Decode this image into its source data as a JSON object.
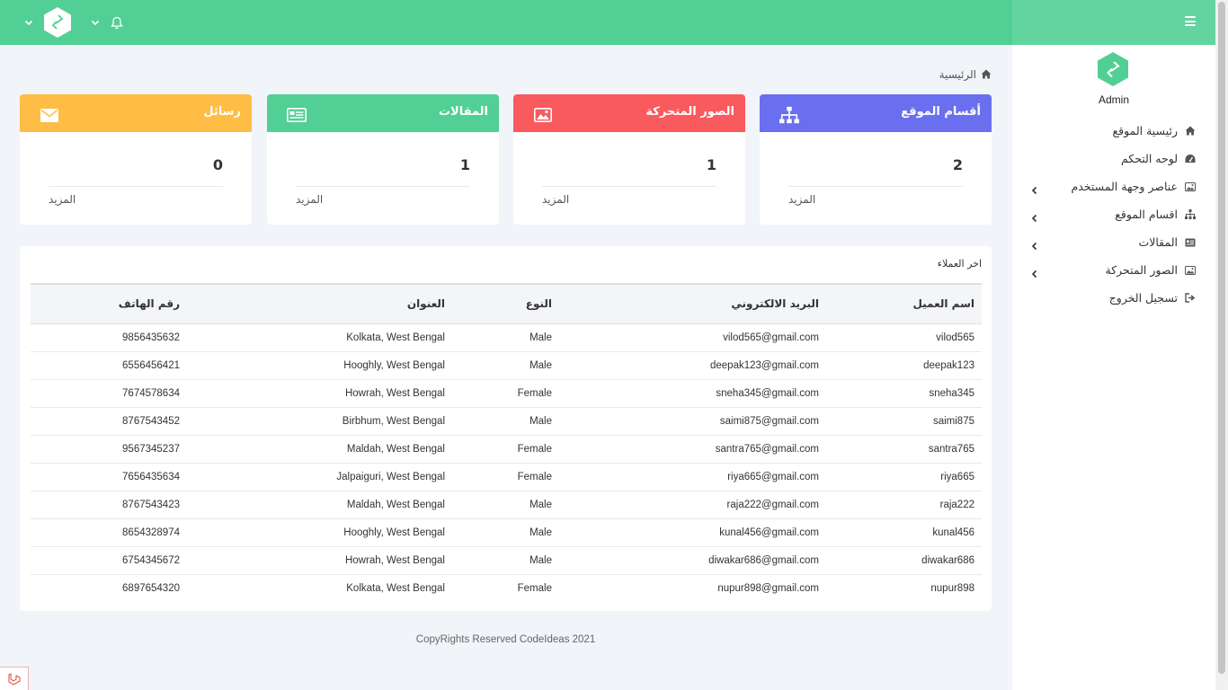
{
  "colors": {
    "brand_green": "#52cf95",
    "card_sections": "#6a6ff0",
    "card_sliders": "#f85a5e",
    "card_articles": "#52cf95",
    "card_messages": "#ffbd45"
  },
  "topbar": {
    "icons": [
      "chevron-down-icon",
      "logo-icon",
      "chevron-down-icon",
      "bell-icon"
    ]
  },
  "sidebar": {
    "user_name": "Admin",
    "items": [
      {
        "label": "رئيسية الموقع",
        "icon": "home-icon",
        "has_submenu": false
      },
      {
        "label": "لوحه التحكم",
        "icon": "dashboard-icon",
        "has_submenu": false
      },
      {
        "label": "عناصر وجهة المستخدم",
        "icon": "image-icon",
        "has_submenu": true
      },
      {
        "label": "اقسام الموقع",
        "icon": "sitemap-icon",
        "has_submenu": true
      },
      {
        "label": "المقالات",
        "icon": "newspaper-icon",
        "has_submenu": true
      },
      {
        "label": "الصور المتحركة",
        "icon": "image-icon",
        "has_submenu": true
      },
      {
        "label": "تسجيل الخروج",
        "icon": "sign-out-icon",
        "has_submenu": false
      }
    ]
  },
  "breadcrumb": {
    "home_label": "الرئيسية"
  },
  "cards": [
    {
      "title": "أقسام الموقع",
      "count": "2",
      "more": "المزيد",
      "icon": "sitemap-icon"
    },
    {
      "title": "الصور المتحركة",
      "count": "1",
      "more": "المزيد",
      "icon": "image-icon"
    },
    {
      "title": "المقالات",
      "count": "1",
      "more": "المزيد",
      "icon": "newspaper-icon"
    },
    {
      "title": "رسائل",
      "count": "0",
      "more": "المزيد",
      "icon": "envelope-icon"
    }
  ],
  "customers": {
    "title": "اخر العملاء",
    "headers": {
      "phone": "رقم الهاتف",
      "address": "العنوان",
      "type": "النوع",
      "email": "البريد الالكتروني",
      "name": "اسم العميل"
    },
    "rows": [
      {
        "phone": "9856435632",
        "address": "Kolkata, West Bengal",
        "type": "Male",
        "email": "vilod565@gmail.com",
        "name": "vilod565"
      },
      {
        "phone": "6556456421",
        "address": "Hooghly, West Bengal",
        "type": "Male",
        "email": "deepak123@gmail.com",
        "name": "deepak123"
      },
      {
        "phone": "7674578634",
        "address": "Howrah, West Bengal",
        "type": "Female",
        "email": "sneha345@gmail.com",
        "name": "sneha345"
      },
      {
        "phone": "8767543452",
        "address": "Birbhum, West Bengal",
        "type": "Male",
        "email": "saimi875@gmail.com",
        "name": "saimi875"
      },
      {
        "phone": "9567345237",
        "address": "Maldah, West Bengal",
        "type": "Female",
        "email": "santra765@gmail.com",
        "name": "santra765"
      },
      {
        "phone": "7656435634",
        "address": "Jalpaiguri, West Bengal",
        "type": "Female",
        "email": "riya665@gmail.com",
        "name": "riya665"
      },
      {
        "phone": "8767543423",
        "address": "Maldah, West Bengal",
        "type": "Male",
        "email": "raja222@gmail.com",
        "name": "raja222"
      },
      {
        "phone": "8654328974",
        "address": "Hooghly, West Bengal",
        "type": "Male",
        "email": "kunal456@gmail.com",
        "name": "kunal456"
      },
      {
        "phone": "6754345672",
        "address": "Howrah, West Bengal",
        "type": "Male",
        "email": "diwakar686@gmail.com",
        "name": "diwakar686"
      },
      {
        "phone": "6897654320",
        "address": "Kolkata, West Bengal",
        "type": "Female",
        "email": "nupur898@gmail.com",
        "name": "nupur898"
      }
    ]
  },
  "footer": {
    "text": "CopyRights Reserved CodeIdeas 2021"
  }
}
